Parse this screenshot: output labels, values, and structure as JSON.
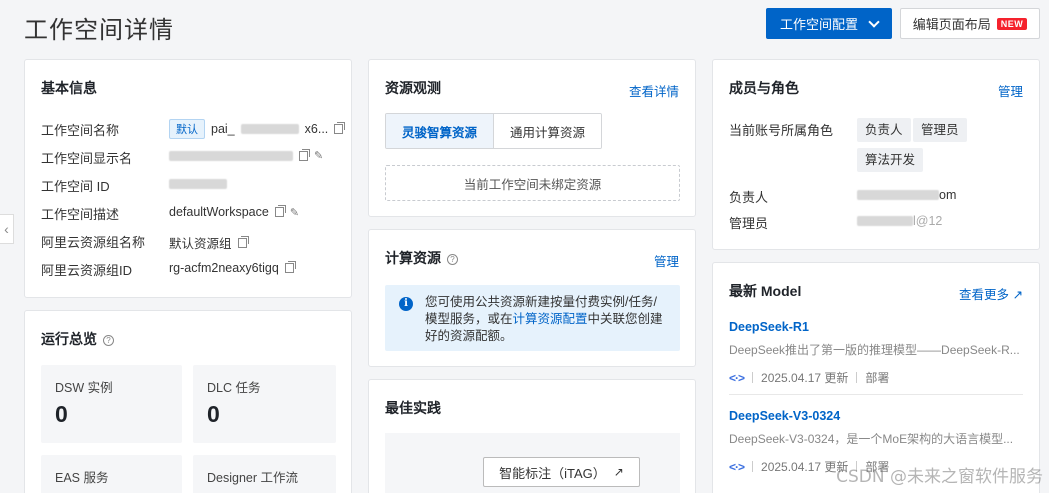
{
  "header": {
    "title": "工作空间详情",
    "config_button": "工作空间配置",
    "edit_layout_button": "编辑页面布局",
    "new_badge": "NEW"
  },
  "basic_info": {
    "title": "基本信息",
    "rows": [
      {
        "label": "工作空间名称",
        "tag": "默认",
        "value": "pai_",
        "value_tail": "x6..."
      },
      {
        "label": "工作空间显示名",
        "value": ""
      },
      {
        "label": "工作空间 ID",
        "value": ""
      },
      {
        "label": "工作空间描述",
        "value": "defaultWorkspace"
      },
      {
        "label": "阿里云资源组名称",
        "value": "默认资源组"
      },
      {
        "label": "阿里云资源组ID",
        "value": "rg-acfm2neaxy6tigq"
      }
    ]
  },
  "overview": {
    "title": "运行总览",
    "metrics": [
      {
        "label": "DSW 实例",
        "value": "0"
      },
      {
        "label": "DLC 任务",
        "value": "0"
      },
      {
        "label": "EAS 服务",
        "value": ""
      },
      {
        "label": "Designer 工作流",
        "value": ""
      }
    ]
  },
  "resource_watch": {
    "title": "资源观测",
    "link": "查看详情",
    "tabs": [
      "灵骏智算资源",
      "通用计算资源"
    ],
    "empty_text": "当前工作空间未绑定资源"
  },
  "compute": {
    "title": "计算资源",
    "link": "管理",
    "info_before": "您可使用公共资源新建按量付费实例/任务/模型服务，或在",
    "info_link": "计算资源配置",
    "info_after": "中关联您创建好的资源配额。"
  },
  "best_practice": {
    "title": "最佳实践",
    "itag_label": "智能标注（iTAG）"
  },
  "members": {
    "title": "成员与角色",
    "link": "管理",
    "role_label": "当前账号所属角色",
    "roles": [
      "负责人",
      "管理员",
      "算法开发"
    ],
    "owner_label": "负责人",
    "owner_value_tail": "om",
    "admin_label": "管理员",
    "admin_value": "l@12"
  },
  "models": {
    "title": "最新 Model",
    "link": "查看更多",
    "items": [
      {
        "name": "DeepSeek-R1",
        "desc": "DeepSeek推出了第一版的推理模型——DeepSeek-R...",
        "date": "2025.04.17 更新",
        "action": "部署"
      },
      {
        "name": "DeepSeek-V3-0324",
        "desc": "DeepSeek-V3-0324，是一个MoE架构的大语言模型...",
        "date": "2025.04.17 更新",
        "action": "部署"
      }
    ]
  },
  "watermark": "CSDN @未来之窗软件服务"
}
